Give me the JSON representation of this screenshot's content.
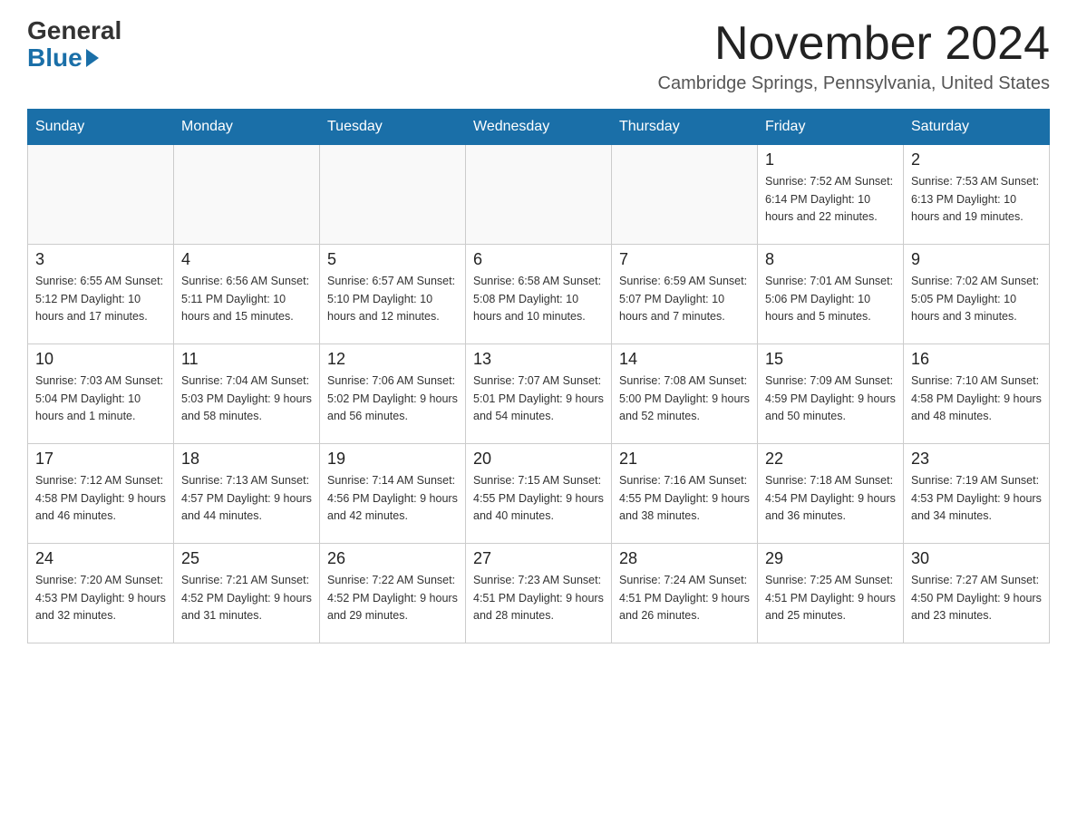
{
  "header": {
    "logo_general": "General",
    "logo_blue": "Blue",
    "month_title": "November 2024",
    "location": "Cambridge Springs, Pennsylvania, United States"
  },
  "days_of_week": [
    "Sunday",
    "Monday",
    "Tuesday",
    "Wednesday",
    "Thursday",
    "Friday",
    "Saturday"
  ],
  "weeks": [
    {
      "days": [
        {
          "num": "",
          "info": ""
        },
        {
          "num": "",
          "info": ""
        },
        {
          "num": "",
          "info": ""
        },
        {
          "num": "",
          "info": ""
        },
        {
          "num": "",
          "info": ""
        },
        {
          "num": "1",
          "info": "Sunrise: 7:52 AM\nSunset: 6:14 PM\nDaylight: 10 hours\nand 22 minutes."
        },
        {
          "num": "2",
          "info": "Sunrise: 7:53 AM\nSunset: 6:13 PM\nDaylight: 10 hours\nand 19 minutes."
        }
      ]
    },
    {
      "days": [
        {
          "num": "3",
          "info": "Sunrise: 6:55 AM\nSunset: 5:12 PM\nDaylight: 10 hours\nand 17 minutes."
        },
        {
          "num": "4",
          "info": "Sunrise: 6:56 AM\nSunset: 5:11 PM\nDaylight: 10 hours\nand 15 minutes."
        },
        {
          "num": "5",
          "info": "Sunrise: 6:57 AM\nSunset: 5:10 PM\nDaylight: 10 hours\nand 12 minutes."
        },
        {
          "num": "6",
          "info": "Sunrise: 6:58 AM\nSunset: 5:08 PM\nDaylight: 10 hours\nand 10 minutes."
        },
        {
          "num": "7",
          "info": "Sunrise: 6:59 AM\nSunset: 5:07 PM\nDaylight: 10 hours\nand 7 minutes."
        },
        {
          "num": "8",
          "info": "Sunrise: 7:01 AM\nSunset: 5:06 PM\nDaylight: 10 hours\nand 5 minutes."
        },
        {
          "num": "9",
          "info": "Sunrise: 7:02 AM\nSunset: 5:05 PM\nDaylight: 10 hours\nand 3 minutes."
        }
      ]
    },
    {
      "days": [
        {
          "num": "10",
          "info": "Sunrise: 7:03 AM\nSunset: 5:04 PM\nDaylight: 10 hours\nand 1 minute."
        },
        {
          "num": "11",
          "info": "Sunrise: 7:04 AM\nSunset: 5:03 PM\nDaylight: 9 hours\nand 58 minutes."
        },
        {
          "num": "12",
          "info": "Sunrise: 7:06 AM\nSunset: 5:02 PM\nDaylight: 9 hours\nand 56 minutes."
        },
        {
          "num": "13",
          "info": "Sunrise: 7:07 AM\nSunset: 5:01 PM\nDaylight: 9 hours\nand 54 minutes."
        },
        {
          "num": "14",
          "info": "Sunrise: 7:08 AM\nSunset: 5:00 PM\nDaylight: 9 hours\nand 52 minutes."
        },
        {
          "num": "15",
          "info": "Sunrise: 7:09 AM\nSunset: 4:59 PM\nDaylight: 9 hours\nand 50 minutes."
        },
        {
          "num": "16",
          "info": "Sunrise: 7:10 AM\nSunset: 4:58 PM\nDaylight: 9 hours\nand 48 minutes."
        }
      ]
    },
    {
      "days": [
        {
          "num": "17",
          "info": "Sunrise: 7:12 AM\nSunset: 4:58 PM\nDaylight: 9 hours\nand 46 minutes."
        },
        {
          "num": "18",
          "info": "Sunrise: 7:13 AM\nSunset: 4:57 PM\nDaylight: 9 hours\nand 44 minutes."
        },
        {
          "num": "19",
          "info": "Sunrise: 7:14 AM\nSunset: 4:56 PM\nDaylight: 9 hours\nand 42 minutes."
        },
        {
          "num": "20",
          "info": "Sunrise: 7:15 AM\nSunset: 4:55 PM\nDaylight: 9 hours\nand 40 minutes."
        },
        {
          "num": "21",
          "info": "Sunrise: 7:16 AM\nSunset: 4:55 PM\nDaylight: 9 hours\nand 38 minutes."
        },
        {
          "num": "22",
          "info": "Sunrise: 7:18 AM\nSunset: 4:54 PM\nDaylight: 9 hours\nand 36 minutes."
        },
        {
          "num": "23",
          "info": "Sunrise: 7:19 AM\nSunset: 4:53 PM\nDaylight: 9 hours\nand 34 minutes."
        }
      ]
    },
    {
      "days": [
        {
          "num": "24",
          "info": "Sunrise: 7:20 AM\nSunset: 4:53 PM\nDaylight: 9 hours\nand 32 minutes."
        },
        {
          "num": "25",
          "info": "Sunrise: 7:21 AM\nSunset: 4:52 PM\nDaylight: 9 hours\nand 31 minutes."
        },
        {
          "num": "26",
          "info": "Sunrise: 7:22 AM\nSunset: 4:52 PM\nDaylight: 9 hours\nand 29 minutes."
        },
        {
          "num": "27",
          "info": "Sunrise: 7:23 AM\nSunset: 4:51 PM\nDaylight: 9 hours\nand 28 minutes."
        },
        {
          "num": "28",
          "info": "Sunrise: 7:24 AM\nSunset: 4:51 PM\nDaylight: 9 hours\nand 26 minutes."
        },
        {
          "num": "29",
          "info": "Sunrise: 7:25 AM\nSunset: 4:51 PM\nDaylight: 9 hours\nand 25 minutes."
        },
        {
          "num": "30",
          "info": "Sunrise: 7:27 AM\nSunset: 4:50 PM\nDaylight: 9 hours\nand 23 minutes."
        }
      ]
    }
  ]
}
